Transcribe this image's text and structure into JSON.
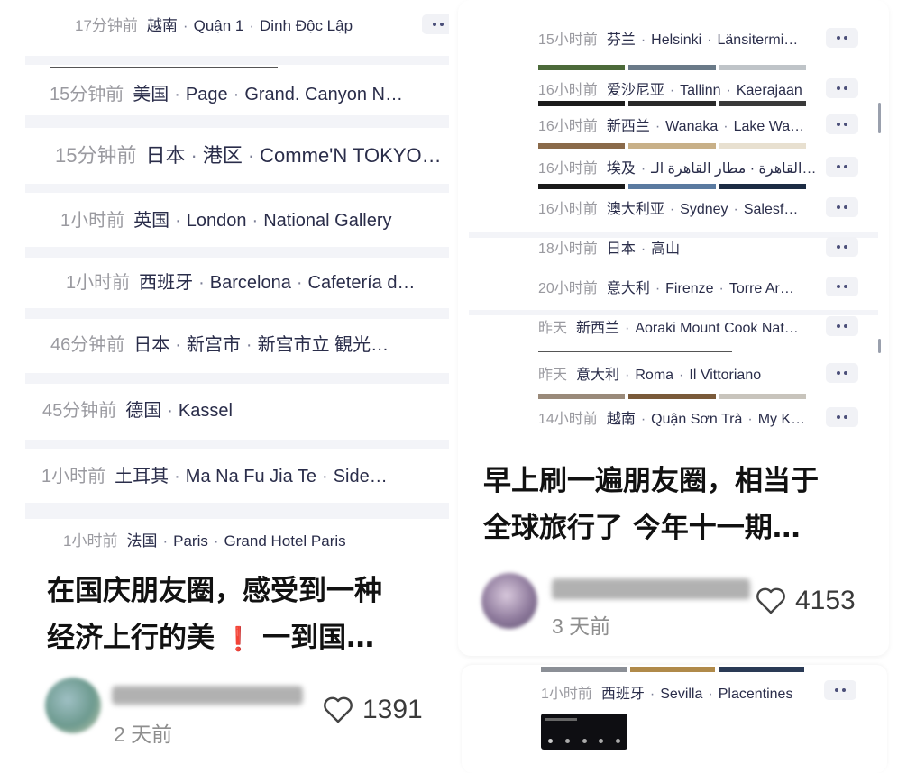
{
  "left_post": {
    "checkins": [
      {
        "time": "17分钟前",
        "parts": [
          "越南",
          "Quận 1",
          "Dinh Độc Lập"
        ]
      },
      {
        "time": "15分钟前",
        "parts": [
          "美国",
          "Page",
          "Grand. Canyon N…"
        ]
      },
      {
        "time": "15分钟前",
        "parts": [
          "日本",
          "港区",
          "Comme'N TOKYO…"
        ]
      },
      {
        "time": "1小时前",
        "parts": [
          "英国",
          "London",
          "National Gallery"
        ]
      },
      {
        "time": "1小时前",
        "parts": [
          "西班牙",
          "Barcelona",
          "Cafetería d…"
        ]
      },
      {
        "time": "46分钟前",
        "parts": [
          "日本",
          "新宫市",
          "新宫市立 観光…"
        ]
      },
      {
        "time": "45分钟前",
        "parts": [
          "德国",
          "Kassel"
        ]
      },
      {
        "time": "1小时前",
        "parts": [
          "土耳其",
          "Ma Na Fu Jia Te",
          "Side…"
        ]
      },
      {
        "time": "1小时前",
        "parts": [
          "法国",
          "Paris",
          "Grand Hotel Paris"
        ]
      }
    ],
    "caption_line1": "在国庆朋友圈，感受到一种",
    "caption_line2": "经济上行的美",
    "caption_emoji": "❗",
    "caption_line2_tail": " 一到国…",
    "time_ago": "2 天前",
    "likes": "1391",
    "accent_color": "#2a2d4a"
  },
  "right_post": {
    "checkins": [
      {
        "time": "15小时前",
        "parts": [
          "芬兰",
          "Helsinki",
          "Länsitermi…"
        ]
      },
      {
        "time": "16小时前",
        "parts": [
          "爱沙尼亚",
          "Tallinn",
          "Kaerajaan"
        ]
      },
      {
        "time": "16小时前",
        "parts": [
          "新西兰",
          "Wanaka",
          "Lake Wa…"
        ]
      },
      {
        "time": "16小时前",
        "parts": [
          "埃及",
          "القاهرة · مطار القاهرة الـ…"
        ]
      },
      {
        "time": "16小时前",
        "parts": [
          "澳大利亚",
          "Sydney",
          "Salesf…"
        ]
      },
      {
        "time": "18小时前",
        "parts": [
          "日本",
          "高山"
        ]
      },
      {
        "time": "20小时前",
        "parts": [
          "意大利",
          "Firenze",
          "Torre Ar…"
        ]
      },
      {
        "time": "昨天",
        "parts": [
          "新西兰",
          "Aoraki Mount Cook Nat…"
        ]
      },
      {
        "time": "昨天",
        "parts": [
          "意大利",
          "Roma",
          "Il Vittoriano"
        ]
      },
      {
        "time": "14小时前",
        "parts": [
          "越南",
          "Quận Sơn Trà",
          "My K…"
        ]
      }
    ],
    "caption_line1": "早上刷一遍朋友圈，相当于",
    "caption_line2": "全球旅行了 今年十一期…",
    "time_ago": "3 天前",
    "likes": "4153"
  },
  "bottom_post": {
    "checkin": {
      "time": "1小时前",
      "parts": [
        "西班牙",
        "Sevilla",
        "Placentines"
      ]
    }
  },
  "icons": {
    "more": "more-dots-icon",
    "like": "heart-outline-icon"
  }
}
